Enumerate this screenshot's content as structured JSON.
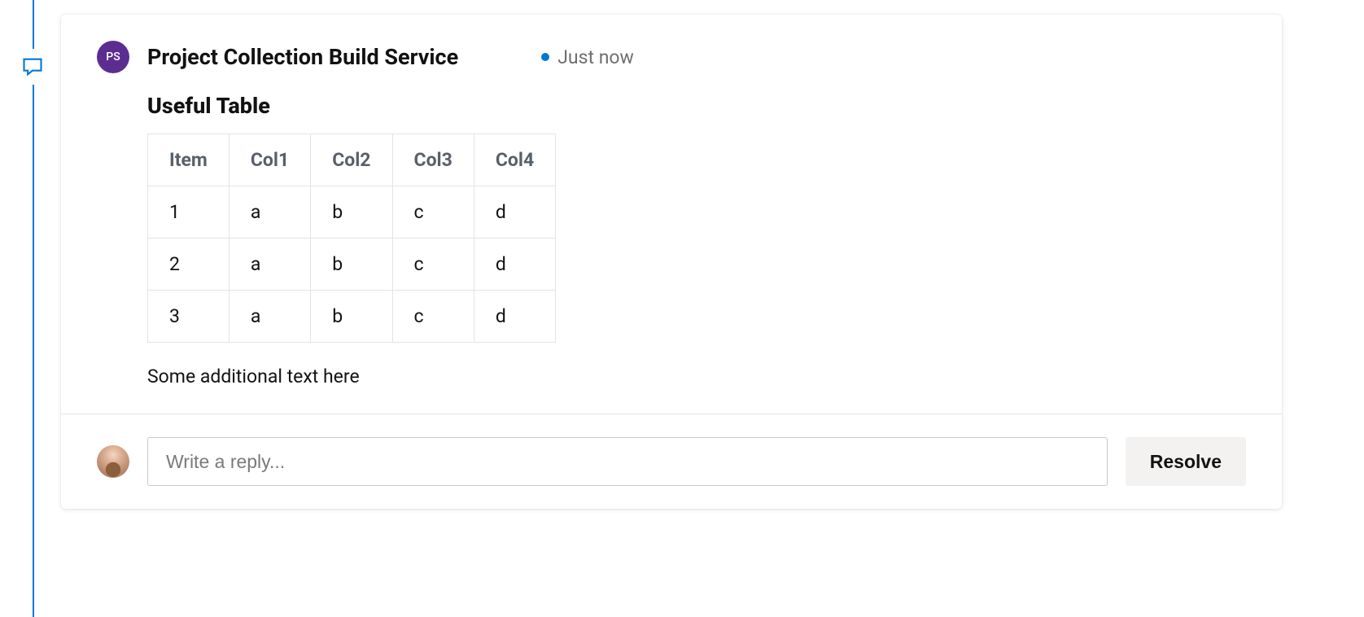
{
  "comment": {
    "author_initials": "PS",
    "author_name": "Project Collection Build Service",
    "timestamp": "Just now",
    "title": "Useful Table",
    "table": {
      "headers": [
        "Item",
        "Col1",
        "Col2",
        "Col3",
        "Col4"
      ],
      "rows": [
        [
          "1",
          "a",
          "b",
          "c",
          "d"
        ],
        [
          "2",
          "a",
          "b",
          "c",
          "d"
        ],
        [
          "3",
          "a",
          "b",
          "c",
          "d"
        ]
      ]
    },
    "additional_text": "Some additional text here"
  },
  "reply": {
    "placeholder": "Write a reply..."
  },
  "actions": {
    "resolve_label": "Resolve"
  },
  "colors": {
    "accent": "#0078d4",
    "avatar_bg": "#5c2d91"
  }
}
